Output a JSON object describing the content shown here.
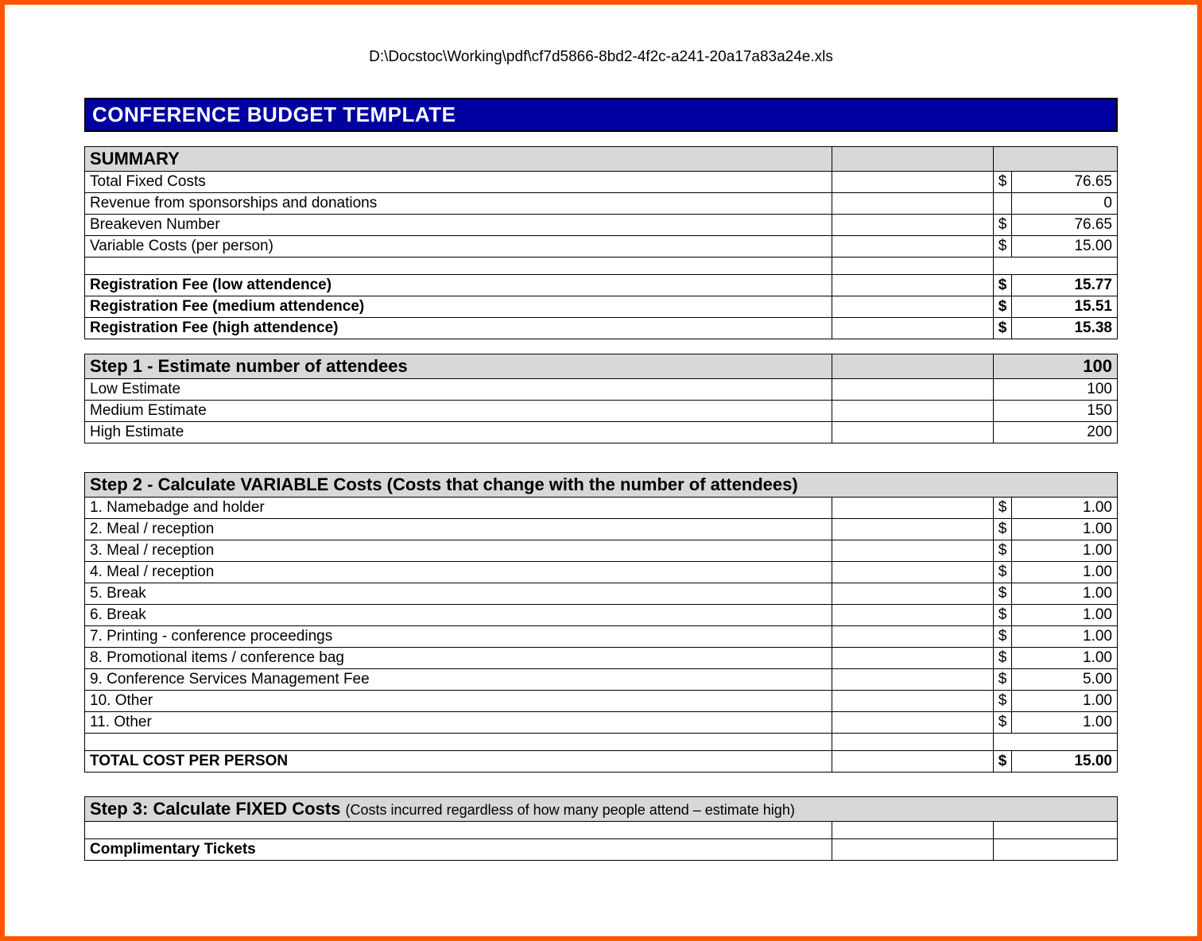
{
  "filepath": "D:\\Docstoc\\Working\\pdf\\cf7d5866-8bd2-4f2c-a241-20a17a83a24e.xls",
  "title": "CONFERENCE BUDGET TEMPLATE",
  "summary": {
    "header": "SUMMARY",
    "rows": [
      {
        "label": "Total Fixed Costs",
        "sym": "$",
        "val": "76.65",
        "bold": false
      },
      {
        "label": "Revenue from sponsorships and donations",
        "sym": "",
        "val": "0",
        "bold": false
      },
      {
        "label": "Breakeven Number",
        "sym": "$",
        "val": "76.65",
        "bold": false
      },
      {
        "label": "Variable Costs (per person)",
        "sym": "$",
        "val": "15.00",
        "bold": false
      }
    ],
    "fee_rows": [
      {
        "label": "Registration Fee (low attendence)",
        "sym": "$",
        "val": "15.77"
      },
      {
        "label": "Registration Fee (medium attendence)",
        "sym": "$",
        "val": "15.51"
      },
      {
        "label": "Registration Fee (high attendence)",
        "sym": "$",
        "val": "15.38"
      }
    ]
  },
  "step1": {
    "header": "Step  1 - Estimate number of attendees",
    "header_val": "100",
    "rows": [
      {
        "label": "Low Estimate",
        "val": "100"
      },
      {
        "label": "Medium Estimate",
        "val": "150"
      },
      {
        "label": "High Estimate",
        "val": "200"
      }
    ]
  },
  "step2": {
    "header": "Step 2 - Calculate VARIABLE Costs (Costs that change with the number of attendees)",
    "rows": [
      {
        "label": "1.  Namebadge and holder",
        "sym": "$",
        "val": "1.00"
      },
      {
        "label": "2.  Meal / reception",
        "sym": "$",
        "val": "1.00"
      },
      {
        "label": "3.  Meal / reception",
        "sym": "$",
        "val": "1.00"
      },
      {
        "label": "4.  Meal / reception",
        "sym": "$",
        "val": "1.00"
      },
      {
        "label": "5.  Break",
        "sym": "$",
        "val": "1.00"
      },
      {
        "label": "6.  Break",
        "sym": "$",
        "val": "1.00"
      },
      {
        "label": "7. Printing - conference proceedings",
        "sym": "$",
        "val": "1.00"
      },
      {
        "label": "8. Promotional items / conference bag",
        "sym": "$",
        "val": "1.00"
      },
      {
        "label": "9. Conference Services Management Fee",
        "sym": "$",
        "val": "5.00"
      },
      {
        "label": "10. Other",
        "sym": "$",
        "val": "1.00"
      },
      {
        "label": "11. Other",
        "sym": "$",
        "val": "1.00"
      }
    ],
    "total_label": "TOTAL COST PER PERSON",
    "total_sym": "$",
    "total_val": "15.00"
  },
  "step3": {
    "header_main": " Step 3:  Calculate FIXED Costs ",
    "header_sub": "(Costs incurred regardless of how many people attend – estimate high)",
    "row1": "Complimentary Tickets"
  }
}
